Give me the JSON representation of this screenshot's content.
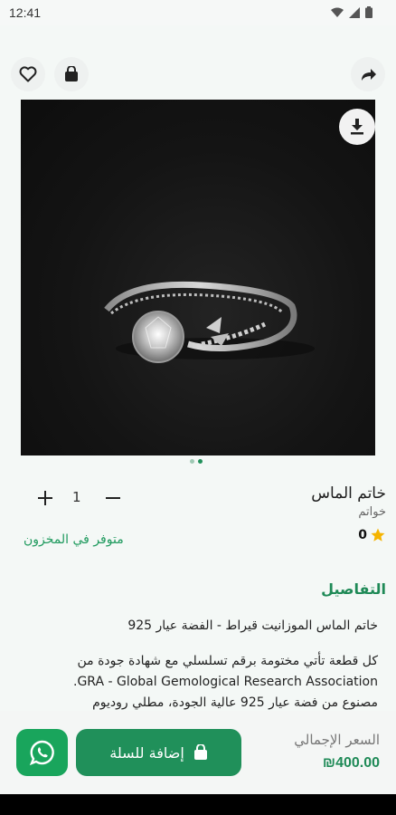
{
  "status_bar": {
    "time": "12:41"
  },
  "icons": {
    "wishlist": "heart-icon",
    "cart": "shopping-bag-icon",
    "share": "share-arrow-icon",
    "download": "download-icon",
    "whatsapp": "whatsapp-icon",
    "star": "star-icon"
  },
  "product": {
    "name": "خاتم الماس",
    "category": "خواتم",
    "rating": "0",
    "quantity": "1",
    "stock_status": "متوفر في المخزون",
    "image_count": 2,
    "active_image_index": 2
  },
  "details": {
    "heading": "التفاصيل",
    "lines": [
      "خاتم الماس الموزانيت قيراط - الفضة عيار 925",
      "كل قطعة تأتي مختومة برقم تسلسلي مع شهادة جودة من",
      "GRA - Global Gemological Research Association.",
      "مصنوع من فضة عيار 925 عالية الجودة، مطلي روديوم"
    ]
  },
  "footer": {
    "total_label": "السعر الإجمالي",
    "total_value": "₪400.00",
    "add_to_cart_label": "إضافة للسلة"
  },
  "colors": {
    "accent": "#20905a",
    "whatsapp": "#19a55c",
    "star": "#f5b400",
    "stock": "#1f9a5e"
  }
}
